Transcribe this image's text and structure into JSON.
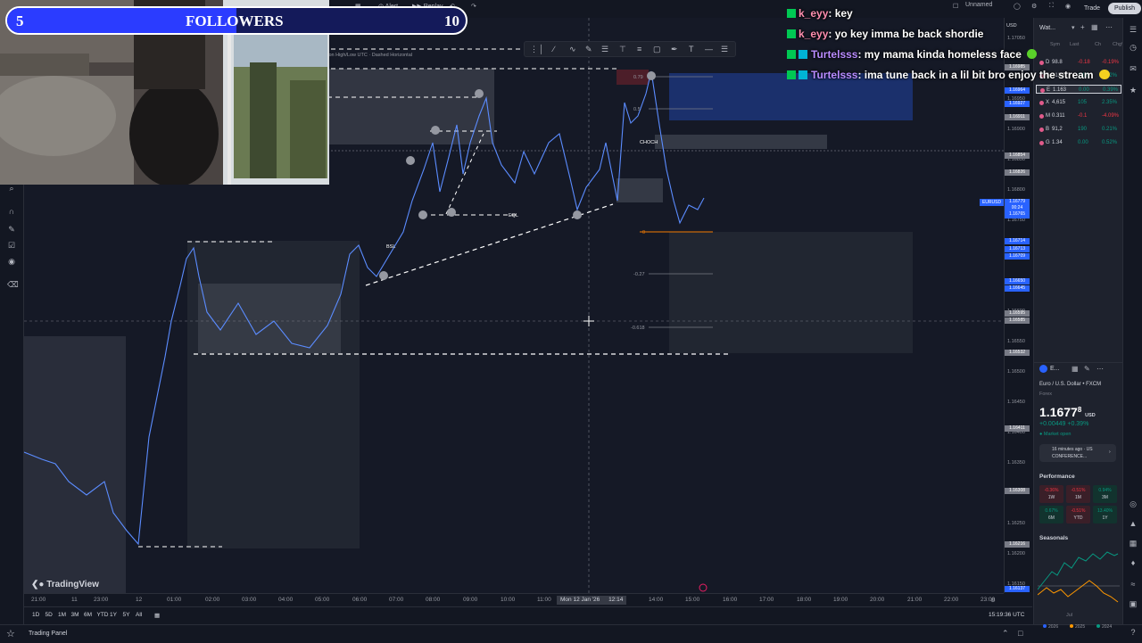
{
  "overlay": {
    "followers": {
      "current": "5",
      "label": "FOLLOWERS",
      "goal": "10",
      "progress": 0.5
    },
    "chat": [
      {
        "user": "k_eyy",
        "user_color": "#ff8fb0",
        "message": ": key"
      },
      {
        "user": "k_eyy",
        "user_color": "#ff8fb0",
        "message": ": yo key imma be back shordie"
      },
      {
        "user": "Turtelsss",
        "user_color": "#b98cff",
        "message": ": my mama kinda homeless face"
      },
      {
        "user": "Turtelsss",
        "user_color": "#b98cff",
        "message": ": ima tune back in a lil bit bro enjoy the stream"
      }
    ]
  },
  "toolbar": {
    "alert": "Alert",
    "replay": "Replay",
    "unnamed": "Unnamed",
    "trade": "Trade",
    "publish": "Publish",
    "currency": "USD",
    "drawing_caption": "Session High/Low UTC · Dashed Horizontal"
  },
  "chart": {
    "symbol_tag": "EURUSD",
    "current_price": "1.16779",
    "countdown": "00:24",
    "bid": "1.16765",
    "crosshair_date": "Mon 12 Jan '26",
    "crosshair_time": "12:14",
    "watermark": "TradingView",
    "labels": {
      "eql": "EQL",
      "bsl": "BSL",
      "choch": "CHOCH",
      "fib0": "0",
      "fib_neg027": "-0.27",
      "fib_neg0618": "-0.618",
      "fib_top": "0.79",
      "fib_mid": "0.5"
    },
    "price_ticks": [
      "1.17050",
      "1.17000",
      "1.16950",
      "1.16900",
      "1.16850",
      "1.16800",
      "1.16750",
      "1.16700",
      "1.16650",
      "1.16600",
      "1.16550",
      "1.16500",
      "1.16450",
      "1.16400",
      "1.16350",
      "1.16300",
      "1.16250",
      "1.16200",
      "1.16150"
    ],
    "price_tags": [
      "1.16985",
      "1.16964",
      "1.16927",
      "1.16911",
      "1.16854",
      "1.16826",
      "1.16714",
      "1.16713",
      "1.16709",
      "1.16650",
      "1.16645",
      "1.16595",
      "1.16585",
      "1.16532",
      "1.16411",
      "1.16308",
      "1.16216",
      "1.16137"
    ],
    "time_ticks": [
      "21:00",
      "11",
      "23:00",
      "12",
      "01:00",
      "02:00",
      "03:00",
      "04:00",
      "05:00",
      "06:00",
      "07:00",
      "08:00",
      "09:00",
      "10:00",
      "11:00",
      "12:14",
      "13:00",
      "14:00",
      "15:00",
      "16:00",
      "17:00",
      "18:00",
      "19:00",
      "20:00",
      "21:00",
      "22:00",
      "23:00"
    ],
    "clock": "15:19:36 UTC",
    "ranges": [
      "1D",
      "5D",
      "1M",
      "3M",
      "6M",
      "YTD",
      "1Y",
      "5Y",
      "All"
    ]
  },
  "bottom": {
    "trading_panel": "Trading Panel"
  },
  "watchlist": {
    "title": "Wat...",
    "columns": [
      "Sym",
      "Last",
      "Ch",
      "Chg%"
    ],
    "rows": [
      {
        "sym": "D",
        "last": "98.8",
        "chg": "-0.18",
        "chgp": "-0.19%",
        "color": "#f23645"
      },
      {
        "sym": "G",
        "last": "212.7",
        "chg": "1.13",
        "chgp": "0.52%",
        "color": "#089981"
      },
      {
        "sym": "E",
        "last": "1.163",
        "chg": "0.00",
        "chgp": "0.39%",
        "color": "#089981",
        "selected": true
      },
      {
        "sym": "X",
        "last": "4,615",
        "chg": "105",
        "chgp": "2.35%",
        "color": "#089981"
      },
      {
        "sym": "M",
        "last": "0.311",
        "chg": "-0.1",
        "chgp": "-4.09%",
        "color": "#f23645"
      },
      {
        "sym": "B",
        "last": "91,2",
        "chg": "190",
        "chgp": "0.21%",
        "color": "#089981"
      },
      {
        "sym": "G",
        "last": "1.34",
        "chg": "0.00",
        "chgp": "0.52%",
        "color": "#089981"
      }
    ]
  },
  "details": {
    "short": "E...",
    "name": "Euro / U.S. Dollar",
    "exchange": "FXCM",
    "type": "Forex",
    "price": "1.1677",
    "price_small": "8",
    "currency": "USD",
    "change": "+0.00449",
    "change_pct": "+0.39%",
    "status": "Market open",
    "news_time": "16 minutes ago · US",
    "news_title": "CONFERENCE...",
    "performance_title": "Performance",
    "performance": [
      {
        "value": "-0.36%",
        "period": "1W",
        "color": "#f23645"
      },
      {
        "value": "-0.51%",
        "period": "1M",
        "color": "#f23645"
      },
      {
        "value": "0.94%",
        "period": "3M",
        "color": "#089981"
      },
      {
        "value": "0.67%",
        "period": "6M",
        "color": "#089981"
      },
      {
        "value": "-0.51%",
        "period": "YTD",
        "color": "#f23645"
      },
      {
        "value": "13.40%",
        "period": "1Y",
        "color": "#089981"
      }
    ],
    "seasonals_title": "Seasonals",
    "seasonals_month": "Jul",
    "seasonals_years": [
      "2026",
      "2025",
      "2024"
    ]
  },
  "colors": {
    "accent": "#2962ff",
    "up": "#089981",
    "down": "#f23645",
    "price_line": "#5b8cff"
  }
}
